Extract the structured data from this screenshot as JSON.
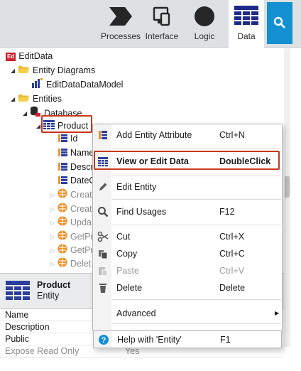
{
  "toolbar": {
    "tabs": [
      {
        "label": "Processes",
        "icon": "process-arrow-icon"
      },
      {
        "label": "Interface",
        "icon": "interface-devices-icon"
      },
      {
        "label": "Logic",
        "icon": "logic-circle-icon"
      },
      {
        "label": "Data",
        "icon": "data-grid-icon",
        "active": true
      }
    ],
    "search_icon": "search-icon"
  },
  "tree": {
    "root": "EditData",
    "root_badge": "Ed",
    "entity_diagrams": "Entity Diagrams",
    "diagram_model": "EditDataDataModel",
    "entities": "Entities",
    "database": "Database",
    "product": "Product",
    "attributes": [
      "Id",
      "Name",
      "Descr",
      "DateC"
    ],
    "actions": [
      "Create",
      "Create",
      "Upda",
      "GetPr",
      "GetPr",
      "Delet"
    ]
  },
  "props": {
    "title": "Product",
    "subtitle": "Entity",
    "rows": [
      {
        "key": "Name",
        "value": ""
      },
      {
        "key": "Description",
        "value": ""
      },
      {
        "key": "Public",
        "value": ""
      },
      {
        "key": "Expose Read Only",
        "value": "Yes"
      }
    ]
  },
  "context_menu": {
    "items": [
      {
        "label": "Add Entity Attribute",
        "shortcut": "Ctrl+N",
        "icon": "add-attribute-icon"
      },
      {
        "label": "View or Edit Data",
        "shortcut": "DoubleClick",
        "icon": "data-grid-icon",
        "bold": true
      },
      {
        "label": "Edit Entity",
        "shortcut": "",
        "icon": "pencil-icon"
      },
      {
        "label": "Find Usages",
        "shortcut": "F12",
        "icon": "magnifier-icon"
      },
      {
        "label": "Cut",
        "shortcut": "Ctrl+X",
        "icon": "scissors-icon"
      },
      {
        "label": "Copy",
        "shortcut": "Ctrl+C",
        "icon": "copy-icon"
      },
      {
        "label": "Paste",
        "shortcut": "Ctrl+V",
        "icon": "paste-icon",
        "disabled": true
      },
      {
        "label": "Delete",
        "shortcut": "Delete",
        "icon": "trash-icon"
      },
      {
        "label": "Advanced",
        "shortcut": "",
        "icon": "",
        "submenu": true
      },
      {
        "label": "Help with 'Entity'",
        "shortcut": "F1",
        "icon": "help-icon"
      }
    ]
  },
  "colors": {
    "accent_blue": "#1290d2",
    "highlight_red": "#c8381b",
    "folder_yellow": "#e8b830",
    "action_orange": "#f08a1c",
    "entity_navy": "#2c3e9e"
  }
}
